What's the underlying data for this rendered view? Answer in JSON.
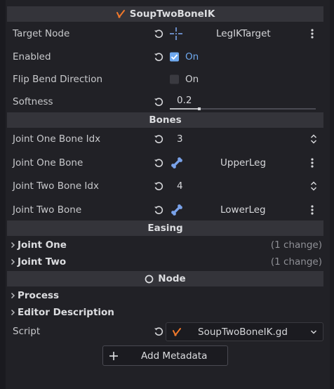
{
  "header": {
    "title": "SoupTwoBoneIK",
    "icon": "ik-node-icon"
  },
  "properties": {
    "target_node": {
      "label": "Target Node",
      "value": "LegIKTarget"
    },
    "enabled": {
      "label": "Enabled",
      "checkbox_label": "On",
      "checked": true
    },
    "flip_bend": {
      "label": "Flip Bend Direction",
      "checkbox_label": "On",
      "checked": false
    },
    "softness": {
      "label": "Softness",
      "value": "0.2",
      "fraction": 0.2
    }
  },
  "bones_section": {
    "title": "Bones"
  },
  "bones": {
    "joint_one_idx": {
      "label": "Joint One Bone Idx",
      "value": "3"
    },
    "joint_one_bone": {
      "label": "Joint One Bone",
      "value": "UpperLeg"
    },
    "joint_two_idx": {
      "label": "Joint Two Bone Idx",
      "value": "4"
    },
    "joint_two_bone": {
      "label": "Joint Two Bone",
      "value": "LowerLeg"
    }
  },
  "easing_section": {
    "title": "Easing"
  },
  "easing": {
    "joint_one": {
      "label": "Joint One",
      "note": "(1 change)"
    },
    "joint_two": {
      "label": "Joint Two",
      "note": "(1 change)"
    }
  },
  "node_section": {
    "title": "Node"
  },
  "node": {
    "process": {
      "label": "Process"
    },
    "editor_description": {
      "label": "Editor Description"
    },
    "script": {
      "label": "Script",
      "value": "SoupTwoBoneIK.gd"
    }
  },
  "add_metadata": {
    "label": "Add Metadata"
  },
  "colors": {
    "accent": "#6fa9ef",
    "ik_icon": "#f0782b",
    "bone_icon": "#7aa3ea"
  }
}
